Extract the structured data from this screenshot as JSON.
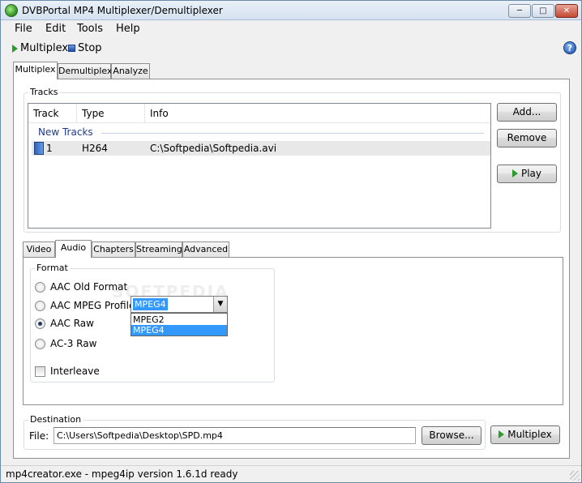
{
  "window": {
    "title": "DVBPortal MP4 Multiplexer/Demultiplexer",
    "min_glyph": "─",
    "max_glyph": "□",
    "close_glyph": "✕"
  },
  "menu": [
    "File",
    "Edit",
    "Tools",
    "Help"
  ],
  "toolbar": {
    "multiplex_label": "Multiplex",
    "stop_label": "Stop",
    "help_glyph": "?"
  },
  "main_tabs": [
    "Multiplex",
    "Demultiplex",
    "Analyze"
  ],
  "tracks": {
    "group_title": "Tracks",
    "columns": [
      "Track",
      "Type",
      "Info"
    ],
    "group_header": "New Tracks",
    "rows": [
      {
        "track": "1",
        "type": "H264",
        "info": "C:\\Softpedia\\Softpedia.avi"
      }
    ],
    "add_label": "Add...",
    "remove_label": "Remove",
    "play_label": "Play"
  },
  "sub_tabs": [
    "Video",
    "Audio",
    "Chapters",
    "Streaming",
    "Advanced"
  ],
  "format": {
    "group_title": "Format",
    "options": [
      "AAC Old Format",
      "AAC MPEG Profile",
      "AAC Raw",
      "AC-3 Raw"
    ],
    "selected_option": "AAC Raw",
    "profile_selected": "MPEG4",
    "profile_options": [
      "MPEG2",
      "MPEG4"
    ],
    "interleave_label": "Interleave",
    "interleave_checked": false
  },
  "destination": {
    "group_title": "Destination",
    "file_label": "File:",
    "file_value": "C:\\Users\\Softpedia\\Desktop\\SPD.mp4",
    "browse_label": "Browse...",
    "multiplex_label": "Multiplex"
  },
  "watermark": "SOFTPEDIA",
  "status": "mp4creator.exe - mpeg4ip version 1.6.1d ready"
}
